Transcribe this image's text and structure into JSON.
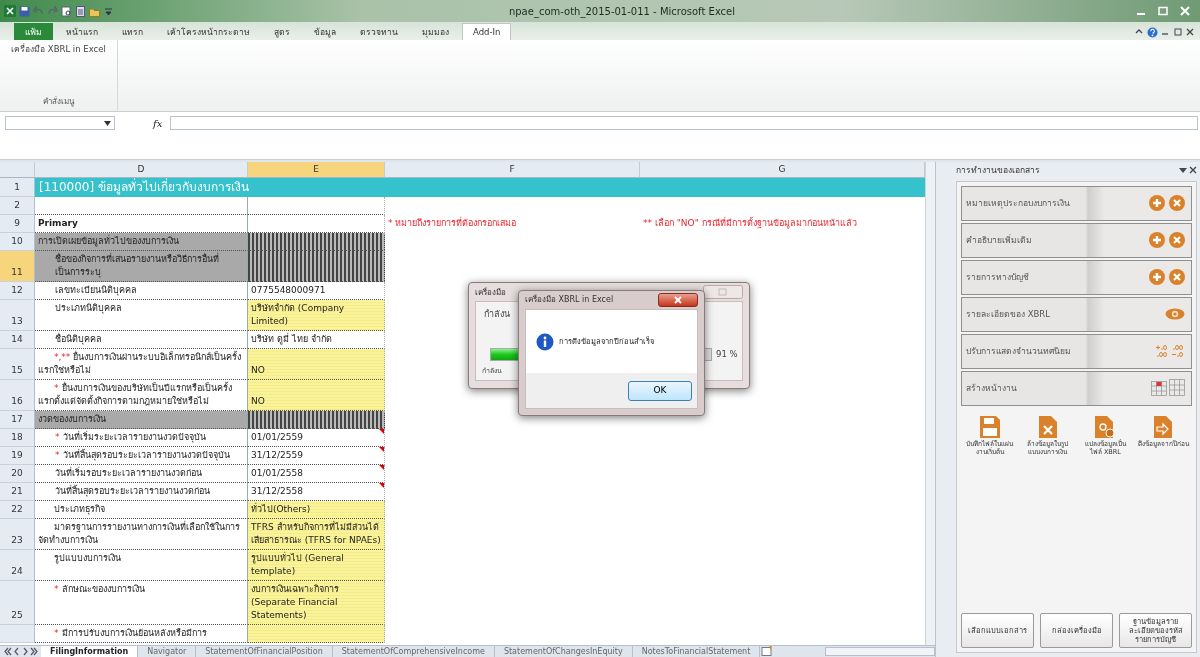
{
  "window": {
    "title": "npae_com-oth_2015-01-011 - Microsoft Excel"
  },
  "ribbon": {
    "tabs": [
      {
        "label": "แฟ้ม",
        "kind": "file",
        "selected": false
      },
      {
        "label": "หน้าแรก",
        "kind": "tab",
        "selected": false
      },
      {
        "label": "แทรก",
        "kind": "tab",
        "selected": false
      },
      {
        "label": "เค้าโครงหน้ากระดาษ",
        "kind": "tab",
        "selected": false
      },
      {
        "label": "สูตร",
        "kind": "tab",
        "selected": false
      },
      {
        "label": "ข้อมูล",
        "kind": "tab",
        "selected": false
      },
      {
        "label": "ตรวจทาน",
        "kind": "tab",
        "selected": false
      },
      {
        "label": "มุมมอง",
        "kind": "tab",
        "selected": false
      },
      {
        "label": "Add-In",
        "kind": "tab",
        "selected": true
      }
    ],
    "menu_button": "เครื่องมือ XBRL in Excel",
    "group_label": "คำสั่งเมนู"
  },
  "formula_bar": {
    "function_label": "fx"
  },
  "sheet": {
    "columns": [
      {
        "label": "D",
        "selected": false
      },
      {
        "label": "E",
        "selected": true
      },
      {
        "label": "F",
        "selected": false
      },
      {
        "label": "G",
        "selected": false
      }
    ],
    "rows": [
      {
        "number": "1",
        "kind": "title",
        "label": "[110000] ข้อมูลทั่วไปเกี่ยวกับงบการเงิน",
        "selected": false
      },
      {
        "number": "2",
        "kind": "blank",
        "selected": false
      },
      {
        "number": "9",
        "kind": "notes",
        "label": "Primary",
        "notes": [
          "* หมายถึงรายการที่ต้องกรอกเสมอ",
          "** เลือก \"NO\" กรณีที่มีการตั้งฐานข้อมูลมาก่อนหน้าแล้ว"
        ],
        "selected": false
      },
      {
        "number": "10",
        "kind": "section",
        "label": "การเปิดเผยข้อมูลทั่วไปของงบการเงิน",
        "selected": false
      },
      {
        "number": "11",
        "kind": "group",
        "label": "ชื่อของกิจการที่เสนอรายงานหรือวิธีการอื่นที่เป็นการระบุ",
        "selected": true
      },
      {
        "number": "12",
        "kind": "subfield",
        "label": "เลขทะเบียนนิติบุคคล",
        "value": "0775548000971",
        "editable": false,
        "comment": false,
        "selected": false
      },
      {
        "number": "13",
        "kind": "subfield",
        "label": "ประเภทนิติบุคคล",
        "value": "บริษัทจำกัด (Company Limited)",
        "editable": true,
        "comment": false,
        "selected": false
      },
      {
        "number": "14",
        "kind": "subfield",
        "label": "ชื่อนิติบุคคล",
        "value": "บริษัท ดูมี่ ไทย จำกัด",
        "editable": false,
        "comment": false,
        "selected": false
      },
      {
        "number": "15",
        "kind": "field",
        "required": "*,**",
        "label": "ยื่นงบการเงินผ่านระบบอิเล็กทรอนิกส์เป็นครั้งแรกใช่หรือไม่",
        "value": "NO",
        "editable": true,
        "comment": false,
        "selected": false
      },
      {
        "number": "16",
        "kind": "field",
        "required": "*",
        "label": "ยื่นงบการเงินของบริษัทเป็นปีแรกหรือเป็นครั้งแรกตั้งแต่จัดตั้งกิจการตามกฎหมายใช่หรือไม่",
        "value": "NO",
        "editable": true,
        "comment": false,
        "selected": false
      },
      {
        "number": "17",
        "kind": "section",
        "label": "งวดของงบการเงิน",
        "selected": false
      },
      {
        "number": "18",
        "kind": "subfield",
        "required": "*",
        "label": "วันที่เริ่มระยะเวลารายงานงวดปัจจุบัน",
        "value": "01/01/2559",
        "editable": false,
        "comment": true,
        "selected": false
      },
      {
        "number": "19",
        "kind": "subfield",
        "required": "*",
        "label": "วันที่สิ้นสุดรอบระยะเวลารายงานงวดปัจจุบัน",
        "value": "31/12/2559",
        "editable": false,
        "comment": true,
        "selected": false
      },
      {
        "number": "20",
        "kind": "subfield",
        "label": "วันที่เริ่มรอบระยะเวลารายงานงวดก่อน",
        "value": "01/01/2558",
        "editable": false,
        "comment": true,
        "selected": false
      },
      {
        "number": "21",
        "kind": "subfield",
        "label": "วันที่สิ้นสุดรอบระยะเวลารายงานงวดก่อน",
        "value": "31/12/2558",
        "editable": false,
        "comment": true,
        "selected": false
      },
      {
        "number": "22",
        "kind": "field",
        "label": "ประเภทธุรกิจ",
        "value": "ทั่วไป(Others)",
        "editable": true,
        "comment": false,
        "selected": false
      },
      {
        "number": "23",
        "kind": "field",
        "label": "มาตรฐานการรายงานทางการเงินที่เลือกใช้ในการจัดทำงบการเงิน",
        "value": "TFRS สำหรับกิจการที่ไม่มีส่วนได้เสียสาธารณะ (TFRS for NPAEs)",
        "editable": true,
        "comment": false,
        "selected": false
      },
      {
        "number": "24",
        "kind": "field",
        "label": "รูปแบบงบการเงิน",
        "value": "รูปแบบทั่วไป (General template)",
        "editable": true,
        "comment": false,
        "selected": false
      },
      {
        "number": "25",
        "kind": "field",
        "required": "*",
        "label": "ลักษณะของงบการเงิน",
        "value": "งบการเงินเฉพาะกิจการ (Separate Financial Statements)",
        "editable": true,
        "comment": false,
        "selected": false
      },
      {
        "number": "",
        "kind": "field",
        "required": "*",
        "label": "มีการปรับงบการเงินย้อนหลังหรือมีการ",
        "editable": true,
        "comment": false,
        "selected": false
      }
    ]
  },
  "progress_dialog": {
    "title": "เครื่องมือ",
    "status": "กำลังน",
    "level": 0.91,
    "percent": "91 %",
    "detail": "กำลังน"
  },
  "message_dialog": {
    "title": "เครื่องมือ XBRL in Excel",
    "message": "การดึงข้อมูลจากปีก่อนสำเร็จ",
    "button": "OK"
  },
  "task_pane": {
    "title": "การทำงานของเอกสาร",
    "rows": [
      {
        "label": "หมายเหตุประกอบงบการเงิน",
        "kind": "add_remove"
      },
      {
        "label": "คำอธิบายเพิ่มเติม",
        "kind": "add_remove"
      },
      {
        "label": "รายการทางบัญชี",
        "kind": "add_remove"
      },
      {
        "label": "รายละเอียดของ XBRL",
        "kind": "view"
      },
      {
        "label": "ปรับการแสดงจำนวนทศนิยม",
        "kind": "decimals"
      },
      {
        "label": "สร้างหน้างาน",
        "kind": "table"
      }
    ],
    "tools": [
      {
        "label": "บันทึกไฟล์ในแผ่นงานเริ่มต้น",
        "kind": "save"
      },
      {
        "label": "ล้างข้อมูลในรูปแบบงบการเงิน",
        "kind": "clear"
      },
      {
        "label": "แปลงข้อมูลเป็นไฟล์ XBRL",
        "kind": "convert"
      },
      {
        "label": "ดึงข้อมูลจากปีก่อน",
        "kind": "import"
      }
    ],
    "buttons": [
      "เลือกแบบเอกสาร",
      "กล่องเครื่องมือ",
      "ฐานข้อมูลรายละเอียดของรหัสรายการบัญชี"
    ]
  },
  "sheet_tabs": [
    {
      "label": "FilingInformation",
      "selected": true
    },
    {
      "label": "Navigator",
      "selected": false
    },
    {
      "label": "StatementOfFinancialPosition",
      "selected": false
    },
    {
      "label": "StatementOfComprehensiveIncome",
      "selected": false
    },
    {
      "label": "StatementOfChangesInEquity",
      "selected": false
    },
    {
      "label": "NotesToFinancialStatement",
      "selected": false
    }
  ]
}
